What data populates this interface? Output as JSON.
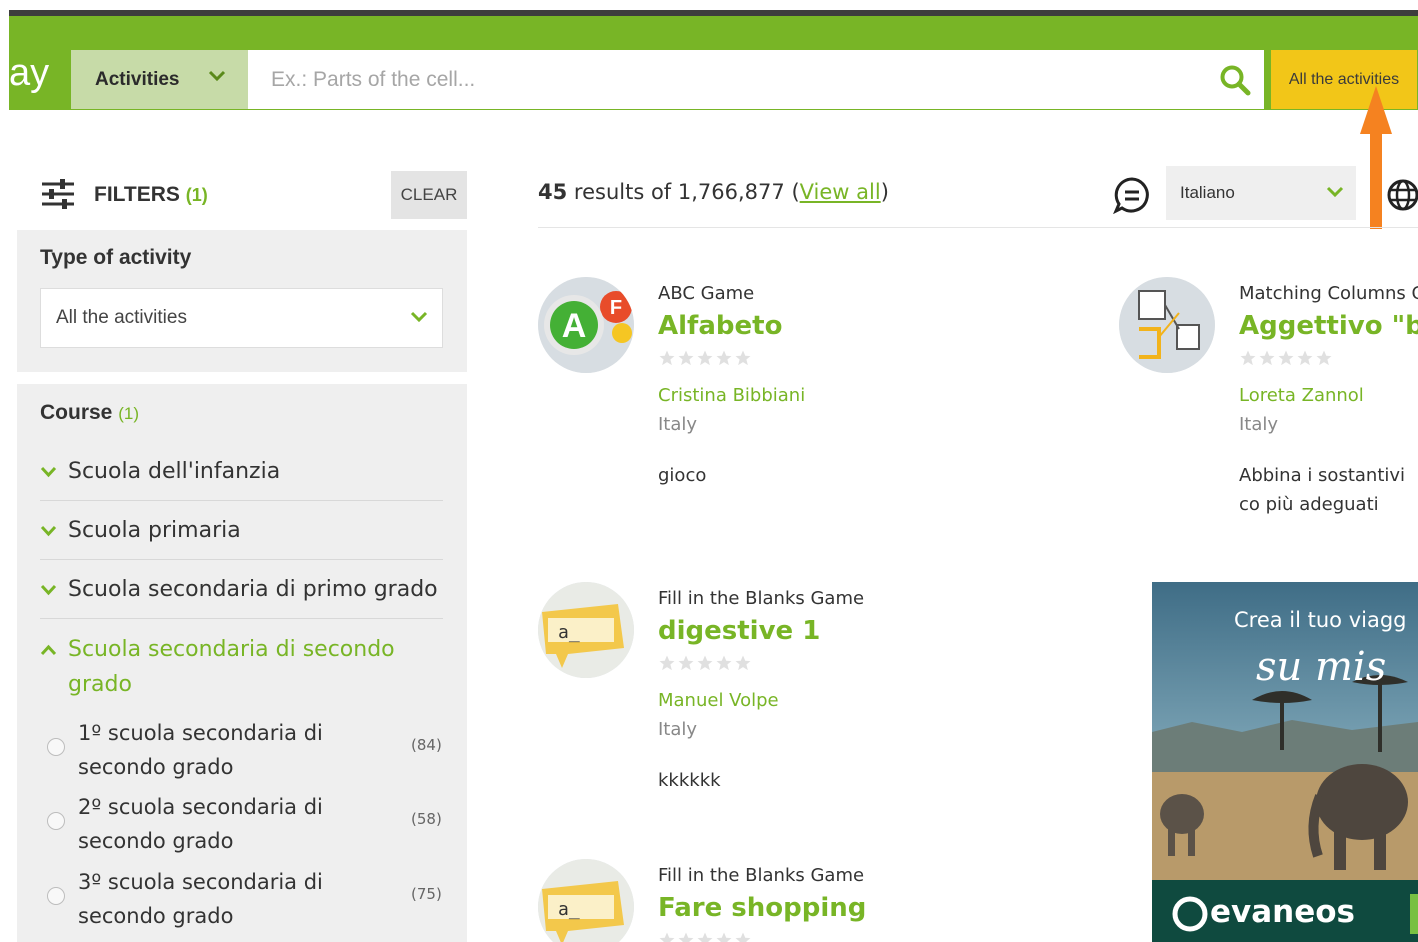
{
  "header": {
    "logo_fragment": "ay",
    "category": "Activities",
    "search_placeholder": "Ex.: Parts of the cell...",
    "all_activities_button": "All the activities"
  },
  "colors": {
    "brand_green": "#78b526",
    "header_yellow": "#f2c618",
    "arrow_orange": "#f58220"
  },
  "filters": {
    "title": "FILTERS",
    "count": "(1)",
    "clear": "CLEAR",
    "type_of_activity": {
      "title": "Type of activity",
      "selected": "All the activities"
    },
    "course": {
      "title": "Course",
      "count": "(1)",
      "items": [
        {
          "label": "Scuola dell'infanzia"
        },
        {
          "label": "Scuola primaria"
        },
        {
          "label": "Scuola secondaria di primo grado"
        },
        {
          "label": "Scuola secondaria di secondo grado"
        }
      ],
      "sub_items": [
        {
          "label": "1º scuola secondaria di secondo grado",
          "count": "(84)"
        },
        {
          "label": "2º scuola secondaria di secondo grado",
          "count": "(58)"
        },
        {
          "label": "3º scuola secondaria di secondo grado",
          "count": "(75)"
        }
      ]
    }
  },
  "results": {
    "count": "45",
    "text": "results of 1,766,877",
    "open_paren": "(",
    "view_all": "View all",
    "close_paren": ")",
    "language": "Italiano"
  },
  "cards": [
    {
      "type": "ABC Game",
      "title": "Alfabeto",
      "author": "Cristina Bibbiani",
      "country": "Italy",
      "description": "gioco",
      "icon": "abc-game-icon"
    },
    {
      "type": "Matching Columns G",
      "title": "Aggettivo \"bell",
      "author": "Loreta Zannol",
      "country": "Italy",
      "description": "Abbina i sostantivi co più adeguati",
      "icon": "matching-columns-icon"
    },
    {
      "type": "Fill in the Blanks Game",
      "title": "digestive 1",
      "author": "Manuel Volpe",
      "country": "Italy",
      "description": "kkkkkk",
      "icon": "fill-blanks-icon"
    },
    {
      "type": "Fill in the Blanks Game",
      "title": "Fare shopping",
      "author": "",
      "country": "",
      "description": "",
      "icon": "fill-blanks-icon"
    }
  ],
  "ad": {
    "headline": "Crea il tuo viagg",
    "script": "su mis",
    "brand": "evaneos"
  }
}
